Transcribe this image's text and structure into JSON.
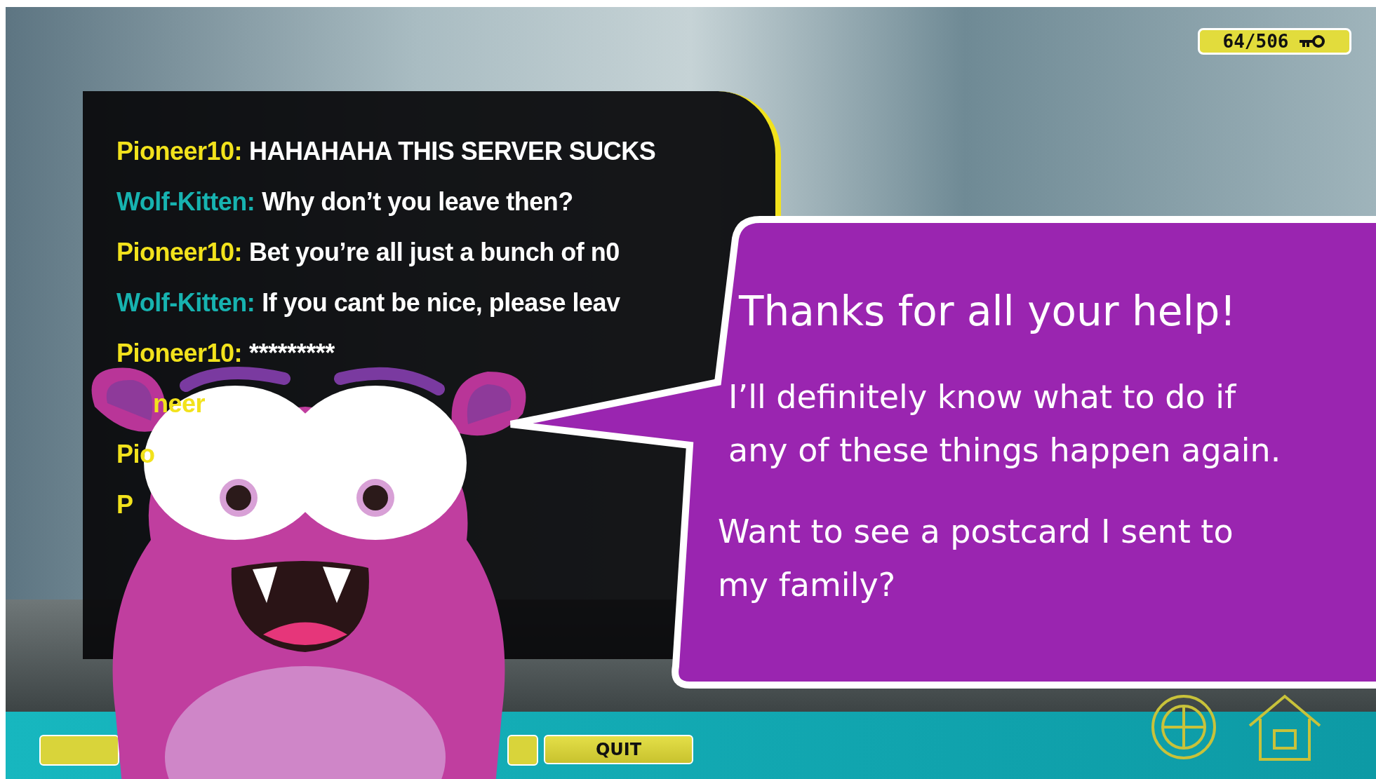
{
  "counter": {
    "text": "64/506"
  },
  "chat": {
    "lines": [
      {
        "kind": "full",
        "speaker": "Pioneer10:",
        "color": "#f2e21c",
        "message": "HAHAHAHA THIS SERVER SUCKS"
      },
      {
        "kind": "full",
        "speaker": "Wolf-Kitten:",
        "color": "#17b3b0",
        "message": "Why don’t you leave then?"
      },
      {
        "kind": "full",
        "speaker": "Pioneer10:",
        "color": "#f2e21c",
        "message": "Bet you’re all just a bunch of n0"
      },
      {
        "kind": "full",
        "speaker": "Wolf-Kitten:",
        "color": "#17b3b0",
        "message": "If you cant be nice, please leav"
      },
      {
        "kind": "full",
        "speaker": "Pioneer10:",
        "color": "#f2e21c",
        "message": "*********"
      },
      {
        "kind": "cut",
        "speaker": "neer",
        "color": "#f2e21c"
      },
      {
        "kind": "full",
        "speaker": "Pio",
        "color": "#f2e21c"
      },
      {
        "kind": "full",
        "speaker": "P",
        "color": "#f2e21c"
      }
    ]
  },
  "speech_bubble": {
    "title": "Thanks for all your help!",
    "paragraphs": [
      [
        "I’ll definitely know what to do if",
        "any of these things happen again."
      ],
      [
        "Want to see a postcard I sent to",
        "my family?"
      ]
    ]
  },
  "bottom_bar": {
    "quit_button": {
      "label": "QUIT"
    }
  }
}
